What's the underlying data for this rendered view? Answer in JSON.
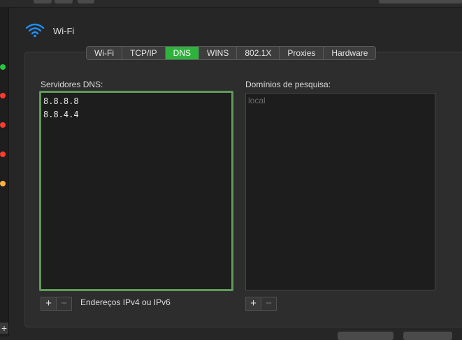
{
  "window": {
    "title": "Wi-Fi",
    "icon": "wifi-icon"
  },
  "tabs": [
    {
      "label": "Wi-Fi",
      "active": false
    },
    {
      "label": "TCP/IP",
      "active": false
    },
    {
      "label": "DNS",
      "active": true
    },
    {
      "label": "WINS",
      "active": false
    },
    {
      "label": "802.1X",
      "active": false
    },
    {
      "label": "Proxies",
      "active": false
    },
    {
      "label": "Hardware",
      "active": false
    }
  ],
  "dns": {
    "label": "Servidores DNS:",
    "servers": [
      "8.8.8.8",
      "8.8.4.4"
    ],
    "add_symbol": "+",
    "remove_symbol": "−",
    "hint": "Endereços IPv4 ou IPv6"
  },
  "search": {
    "label": "Domínios de pesquisa:",
    "placeholder": "local",
    "add_symbol": "+",
    "remove_symbol": "−"
  },
  "sidebar": {
    "status_colors": [
      "#28c840",
      "#ff3b30",
      "#ff3b30",
      "#ff3b30",
      "#ffb340"
    ],
    "add_symbol": "+"
  },
  "colors": {
    "accent": "#2fb23c",
    "focus_ring": "#5f9a58"
  }
}
